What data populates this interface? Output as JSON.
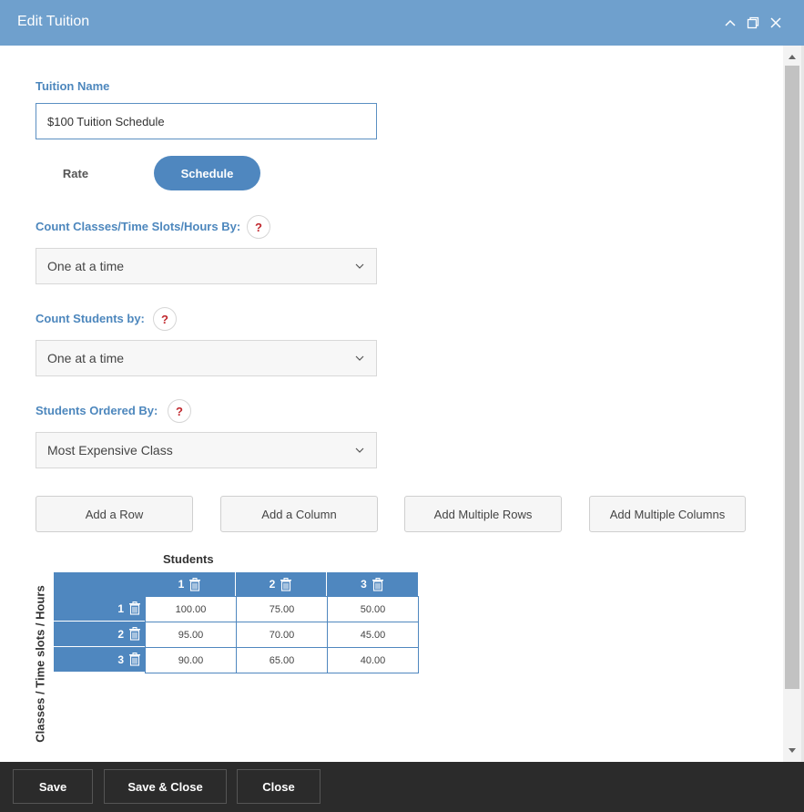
{
  "window": {
    "title": "Edit Tuition"
  },
  "form": {
    "tuition_name_label": "Tuition Name",
    "tuition_name_value": "$100 Tuition Schedule",
    "toggle": {
      "rate_label": "Rate",
      "schedule_label": "Schedule",
      "selected": "Schedule"
    },
    "count_classes": {
      "label": "Count Classes/Time Slots/Hours By:",
      "value": "One at a time"
    },
    "count_students": {
      "label": "Count Students by:",
      "value": "One at a time"
    },
    "students_ordered": {
      "label": "Students Ordered By:",
      "value": "Most Expensive Class"
    },
    "help_glyph": "?"
  },
  "actions": {
    "add_row": "Add a Row",
    "add_column": "Add a Column",
    "add_multiple_rows": "Add Multiple Rows",
    "add_multiple_columns": "Add Multiple Columns"
  },
  "schedule": {
    "students_label": "Students",
    "classes_label": "Classes / Time slots / Hours",
    "columns": [
      "1",
      "2",
      "3"
    ],
    "rows": [
      {
        "label": "1",
        "values": [
          "100.00",
          "75.00",
          "50.00"
        ]
      },
      {
        "label": "2",
        "values": [
          "95.00",
          "70.00",
          "45.00"
        ]
      },
      {
        "label": "3",
        "values": [
          "90.00",
          "65.00",
          "40.00"
        ]
      }
    ]
  },
  "footer": {
    "save": "Save",
    "save_close": "Save & Close",
    "close": "Close"
  },
  "colors": {
    "titlebar": "#6fa0cd",
    "accent": "#4f87bf",
    "label": "#4d87bd",
    "help": "#c0272d",
    "footer": "#2b2b2b"
  },
  "icons": {
    "minimize": "chevron-up-icon",
    "maximize": "restore-icon",
    "close": "close-icon",
    "dropdown": "chevron-down-icon",
    "delete": "trash-icon"
  }
}
